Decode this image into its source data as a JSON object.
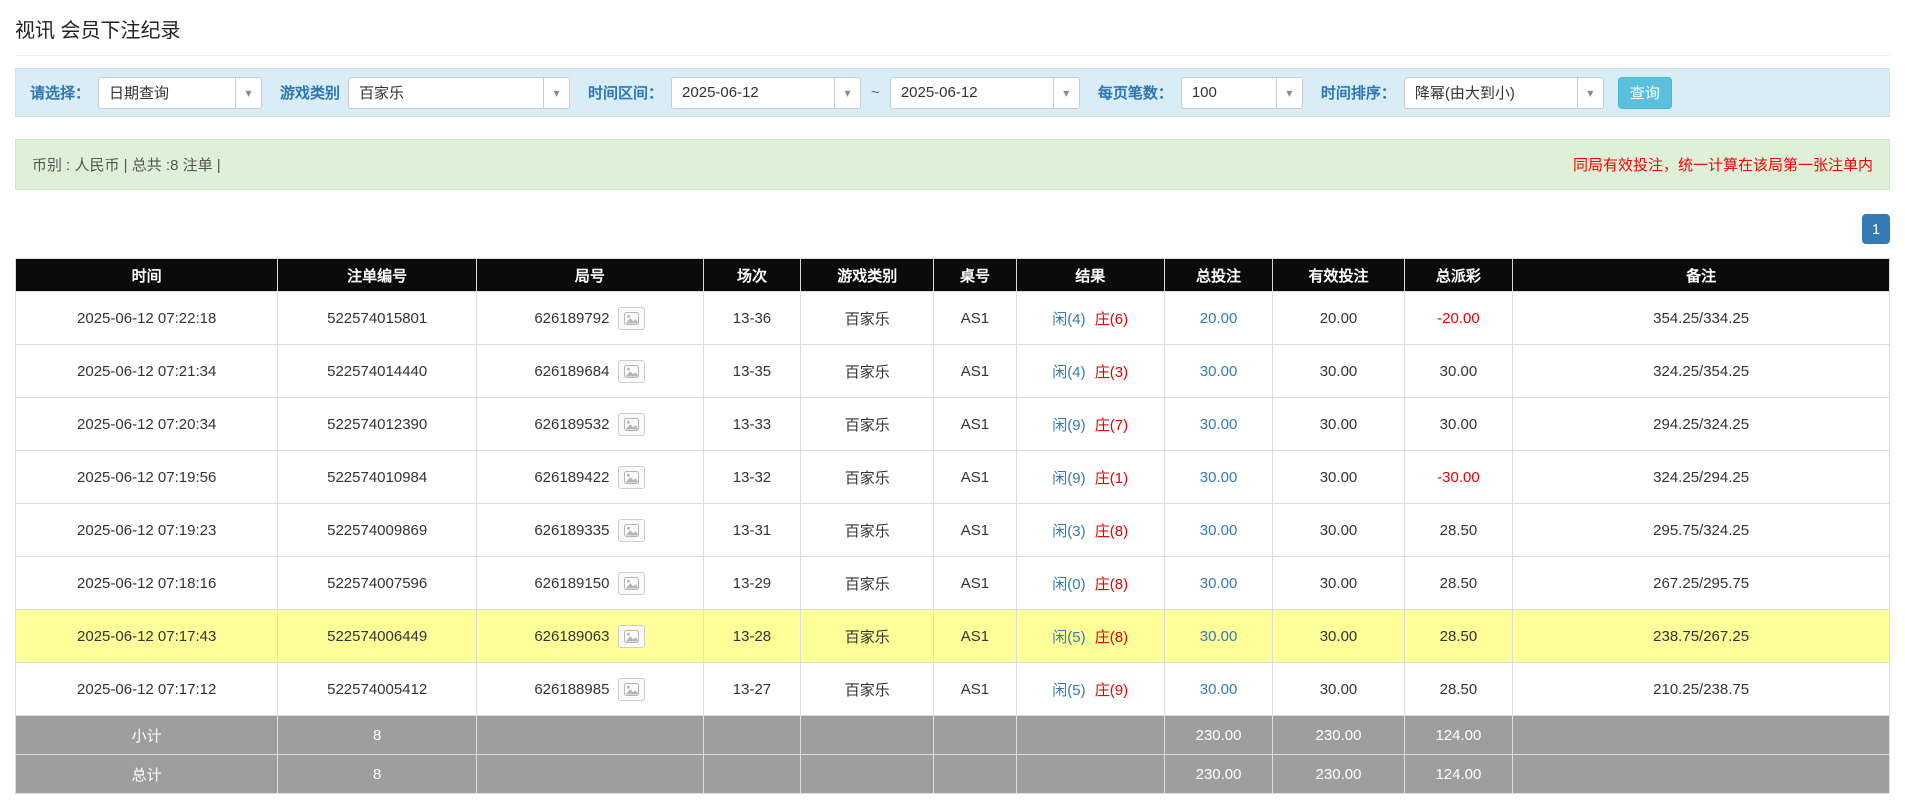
{
  "page": {
    "title": "视讯 会员下注纪录"
  },
  "icons": {
    "chevron_down": "▾",
    "replay_video": "video-thumbnail-icon"
  },
  "filters": {
    "select_label": "请选择：",
    "select_value": "日期查询",
    "game_label": "游戏类别",
    "game_value": "百家乐",
    "date_label": "时间区间：",
    "date_from": "2025-06-12",
    "date_separator": "~",
    "date_to": "2025-06-12",
    "per_page_label": "每页笔数：",
    "per_page_value": "100",
    "sort_label": "时间排序：",
    "sort_value": "降幂(由大到小)",
    "search_button": "查询"
  },
  "summary": {
    "left": "币别 : 人民币 | 总共 :8 注单 |",
    "right": "同局有效投注，统一计算在该局第一张注单内"
  },
  "pagination": {
    "current": "1"
  },
  "table": {
    "headers": [
      "时间",
      "注单编号",
      "局号",
      "场次",
      "游戏类别",
      "桌号",
      "结果",
      "总投注",
      "有效投注",
      "总派彩",
      "备注"
    ],
    "rows": [
      {
        "time": "2025-06-12 07:22:18",
        "bet_id": "522574015801",
        "round_id": "626189792",
        "session": "13-36",
        "game": "百家乐",
        "table_no": "AS1",
        "result_player": "闲(4)",
        "result_banker": "庄(6)",
        "total_bet": "20.00",
        "valid_bet": "20.00",
        "payout": "-20.00",
        "remark": "354.25/334.25",
        "highlight": false
      },
      {
        "time": "2025-06-12 07:21:34",
        "bet_id": "522574014440",
        "round_id": "626189684",
        "session": "13-35",
        "game": "百家乐",
        "table_no": "AS1",
        "result_player": "闲(4)",
        "result_banker": "庄(3)",
        "total_bet": "30.00",
        "valid_bet": "30.00",
        "payout": "30.00",
        "remark": "324.25/354.25",
        "highlight": false
      },
      {
        "time": "2025-06-12 07:20:34",
        "bet_id": "522574012390",
        "round_id": "626189532",
        "session": "13-33",
        "game": "百家乐",
        "table_no": "AS1",
        "result_player": "闲(9)",
        "result_banker": "庄(7)",
        "total_bet": "30.00",
        "valid_bet": "30.00",
        "payout": "30.00",
        "remark": "294.25/324.25",
        "highlight": false
      },
      {
        "time": "2025-06-12 07:19:56",
        "bet_id": "522574010984",
        "round_id": "626189422",
        "session": "13-32",
        "game": "百家乐",
        "table_no": "AS1",
        "result_player": "闲(9)",
        "result_banker": "庄(1)",
        "total_bet": "30.00",
        "valid_bet": "30.00",
        "payout": "-30.00",
        "remark": "324.25/294.25",
        "highlight": false
      },
      {
        "time": "2025-06-12 07:19:23",
        "bet_id": "522574009869",
        "round_id": "626189335",
        "session": "13-31",
        "game": "百家乐",
        "table_no": "AS1",
        "result_player": "闲(3)",
        "result_banker": "庄(8)",
        "total_bet": "30.00",
        "valid_bet": "30.00",
        "payout": "28.50",
        "remark": "295.75/324.25",
        "highlight": false
      },
      {
        "time": "2025-06-12 07:18:16",
        "bet_id": "522574007596",
        "round_id": "626189150",
        "session": "13-29",
        "game": "百家乐",
        "table_no": "AS1",
        "result_player": "闲(0)",
        "result_banker": "庄(8)",
        "total_bet": "30.00",
        "valid_bet": "30.00",
        "payout": "28.50",
        "remark": "267.25/295.75",
        "highlight": false
      },
      {
        "time": "2025-06-12 07:17:43",
        "bet_id": "522574006449",
        "round_id": "626189063",
        "session": "13-28",
        "game": "百家乐",
        "table_no": "AS1",
        "result_player": "闲(5)",
        "result_banker": "庄(8)",
        "total_bet": "30.00",
        "valid_bet": "30.00",
        "payout": "28.50",
        "remark": "238.75/267.25",
        "highlight": true
      },
      {
        "time": "2025-06-12 07:17:12",
        "bet_id": "522574005412",
        "round_id": "626188985",
        "session": "13-27",
        "game": "百家乐",
        "table_no": "AS1",
        "result_player": "闲(5)",
        "result_banker": "庄(9)",
        "total_bet": "30.00",
        "valid_bet": "30.00",
        "payout": "28.50",
        "remark": "210.25/238.75",
        "highlight": false
      }
    ],
    "subtotal": {
      "label": "小计",
      "count": "8",
      "total_bet": "230.00",
      "valid_bet": "230.00",
      "payout": "124.00"
    },
    "total": {
      "label": "总计",
      "count": "8",
      "total_bet": "230.00",
      "valid_bet": "230.00",
      "payout": "124.00"
    }
  }
}
